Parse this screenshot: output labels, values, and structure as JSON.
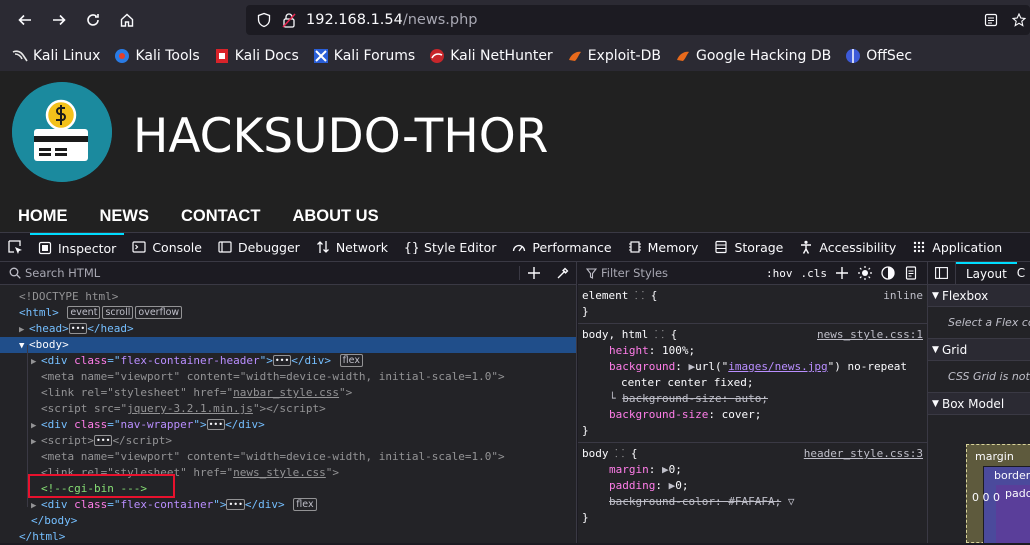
{
  "browser": {
    "url_host": "192.168.1.54",
    "url_path": "/news.php",
    "bookmarks": [
      "Kali Linux",
      "Kali Tools",
      "Kali Docs",
      "Kali Forums",
      "Kali NetHunter",
      "Exploit-DB",
      "Google Hacking DB",
      "OffSec"
    ]
  },
  "site": {
    "title": "HACKSUDO-THOR",
    "nav": [
      "HOME",
      "NEWS",
      "CONTACT",
      "ABOUT US"
    ]
  },
  "devtools": {
    "tabs": [
      "Inspector",
      "Console",
      "Debugger",
      "Network",
      "Style Editor",
      "Performance",
      "Memory",
      "Storage",
      "Accessibility",
      "Application"
    ],
    "search_placeholder": "Search HTML",
    "filter_placeholder": "Filter Styles",
    "hov": ":hov",
    "cls": ".cls",
    "markup": {
      "doctype": "<!DOCTYPE html>",
      "html_open": "<html>",
      "badges": [
        "event",
        "scroll",
        "overflow"
      ],
      "head": "<head>",
      "head_close": "</head>",
      "body_open": "<body>",
      "div1_class": "flex-container-header",
      "flex": "flex",
      "meta_name": "viewport",
      "meta_content": "width=device-width, initial-scale=1.0",
      "link_rel": "stylesheet",
      "link_href1": "navbar_style.css",
      "script_src": "jquery-3.2.1.min.js",
      "div2_class": "nav-wrapper",
      "link_href2": "news_style.css",
      "comment": "<!--cgi-bin --->",
      "div3_class": "flex-container",
      "body_close": "</body>",
      "html_close": "</html>"
    },
    "styles": {
      "element_label": "element",
      "inline": "inline",
      "rule1_selector": "body, html",
      "rule1_source": "news_style.css:1",
      "rule1_props": [
        {
          "name": "height",
          "value": "100%;"
        },
        {
          "name": "background",
          "value_url": "images/news.jpg",
          "value_rest": "no-repeat"
        },
        {
          "name": "",
          "value": "center center fixed;"
        },
        {
          "name": "background-size",
          "value": "auto;",
          "struck": true
        },
        {
          "name": "background-size",
          "value": "cover;"
        }
      ],
      "rule2_selector": "body",
      "rule2_source": "header_style.css:3",
      "rule2_props": [
        {
          "name": "margin",
          "value": "0;"
        },
        {
          "name": "padding",
          "value": "0;"
        },
        {
          "name": "background-color",
          "value": "#FAFAFA;",
          "struck": true
        }
      ]
    },
    "layout_panel": {
      "tab": "Layout",
      "flexbox": "Flexbox",
      "flexbox_hint": "Select a Flex co",
      "grid": "Grid",
      "grid_hint": "CSS Grid is not",
      "box_model": "Box Model",
      "margin": "margin",
      "border": "border",
      "padding": "pado",
      "zeros": "0 0 0"
    }
  }
}
